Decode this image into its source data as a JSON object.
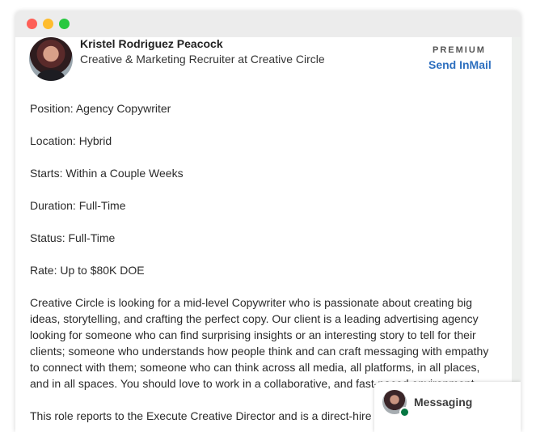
{
  "profile": {
    "name": "Kristel Rodriguez Peacock",
    "headline": "Creative & Marketing Recruiter at Creative Circle",
    "badge": "PREMIUM",
    "cta": "Send InMail"
  },
  "job": {
    "position": "Position: Agency Copywriter",
    "location": "Location: Hybrid",
    "starts": "Starts: Within a Couple Weeks",
    "duration": "Duration: Full-Time",
    "status": "Status: Full-Time",
    "rate": "Rate: Up to $80K DOE",
    "description": "Creative Circle is looking for a mid-level Copywriter who is passionate about creating big ideas, storytelling, and crafting the perfect copy. Our client is a leading advertising agency looking for someone who can find surprising insights or an interesting story to tell for their clients; someone who understands how people think and can craft messaging with empathy to connect with them; someone who can think across all media, all platforms, in all places, and in all spaces. You should love to work in a collaborative, and fast-paced environment.",
    "reports": "This role reports to the Execute Creative Director and is a direct-hire full-time position."
  },
  "messaging": {
    "label": "Messaging"
  },
  "colors": {
    "accent": "#2d6fbf",
    "online": "#057642"
  }
}
